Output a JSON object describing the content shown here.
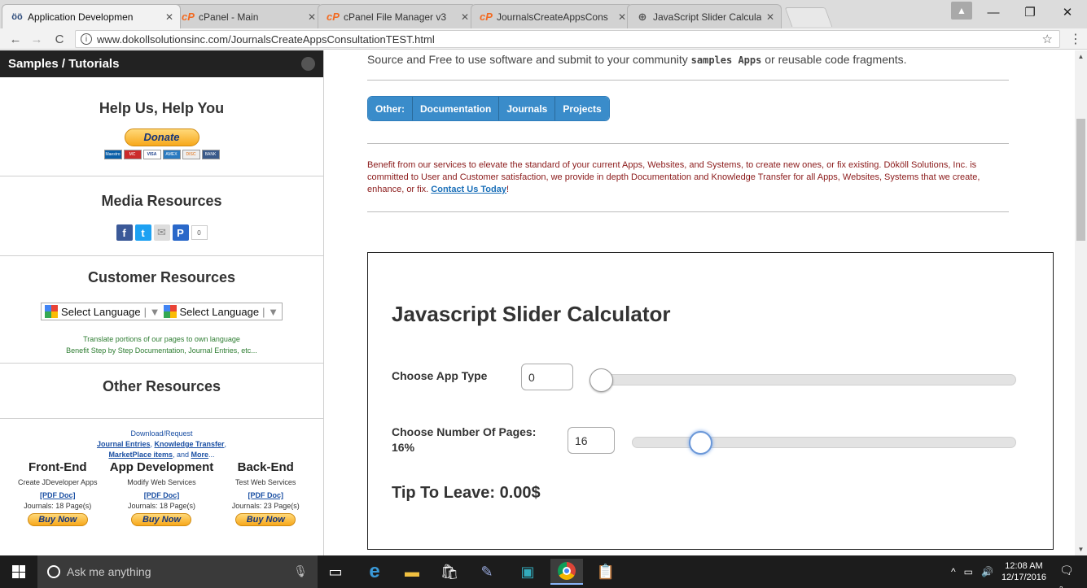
{
  "browser": {
    "tabs": [
      {
        "label": "Application Developmen",
        "icon": "dokoll-icon",
        "active": true
      },
      {
        "label": "cPanel - Main",
        "icon": "cpanel-icon"
      },
      {
        "label": "cPanel File Manager v3",
        "icon": "cpanel-icon"
      },
      {
        "label": "JournalsCreateAppsCons",
        "icon": "cpanel-icon"
      },
      {
        "label": "JavaScript Slider Calculat",
        "icon": "globe-icon"
      }
    ],
    "url": "www.dokollsolutionsinc.com/JournalsCreateAppsConsultationTEST.html"
  },
  "sidebar": {
    "header": "Samples / Tutorials",
    "help_title": "Help Us, Help You",
    "donate_label": "Donate",
    "cards": [
      "Maestro",
      "MC",
      "VISA",
      "AMEX",
      "DISC",
      "BANK"
    ],
    "media_title": "Media Resources",
    "share_count": "0",
    "customer_title": "Customer Resources",
    "lang1": "Select Language",
    "lang2": "Select Language",
    "translate_line1": "Translate portions of our pages to own language",
    "translate_line2": "Benefit Step by Step Documentation, Journal Entries, etc...",
    "other_title": "Other Resources",
    "download_line": "Download/Request",
    "journal_entries": "Journal Entries",
    "knowledge_transfer": "Knowledge Transfer",
    "marketplace": "MarketPlace items",
    "and_more_prefix": ", and ",
    "more": "More",
    "columns": [
      {
        "title": "Front-End",
        "desc": "Create JDeveloper Apps",
        "pdf": "[PDF Doc]",
        "journals": "Journals: 18 Page(s)",
        "buy": "Buy Now"
      },
      {
        "title": "App Development",
        "desc": "Modify Web Services",
        "pdf": "[PDF Doc]",
        "journals": "Journals: 18 Page(s)",
        "buy": "Buy Now"
      },
      {
        "title": "Back-End",
        "desc": "Test Web Services",
        "pdf": "[PDF Doc]",
        "journals": "Journals: 23 Page(s)",
        "buy": "Buy Now"
      }
    ]
  },
  "main": {
    "intro_prefix": "Source and Free to use software and submit to your community ",
    "intro_code": "samples Apps",
    "intro_suffix": " or reusable code fragments.",
    "nav": [
      "Other:",
      "Documentation",
      "Journals",
      "Projects"
    ],
    "benefit_text": "Benefit from our services to elevate the standard of your current Apps, Websites, and Systems, to create new ones, or fix existing. Dököll Solutions, Inc. is committed to User and Customer satisfaction, we provide in depth Documentation and Knowledge Transfer for all Apps, Websites, Systems that we create, enhance, or fix. ",
    "contact_link": "Contact Us Today",
    "benefit_end": "!",
    "calculator": {
      "title": "Javascript Slider Calculator",
      "app_type_label": "Choose App Type",
      "app_type_value": "0",
      "app_type_fraction": 0,
      "pages_label": "Choose Number Of Pages:",
      "pages_percent": "16%",
      "pages_value": "16",
      "pages_fraction": 0.16,
      "tip": "Tip To Leave: 0.00$"
    }
  },
  "taskbar": {
    "search_placeholder": "Ask me anything",
    "time": "12:08 AM",
    "date": "12/17/2016",
    "notifications": "2"
  }
}
